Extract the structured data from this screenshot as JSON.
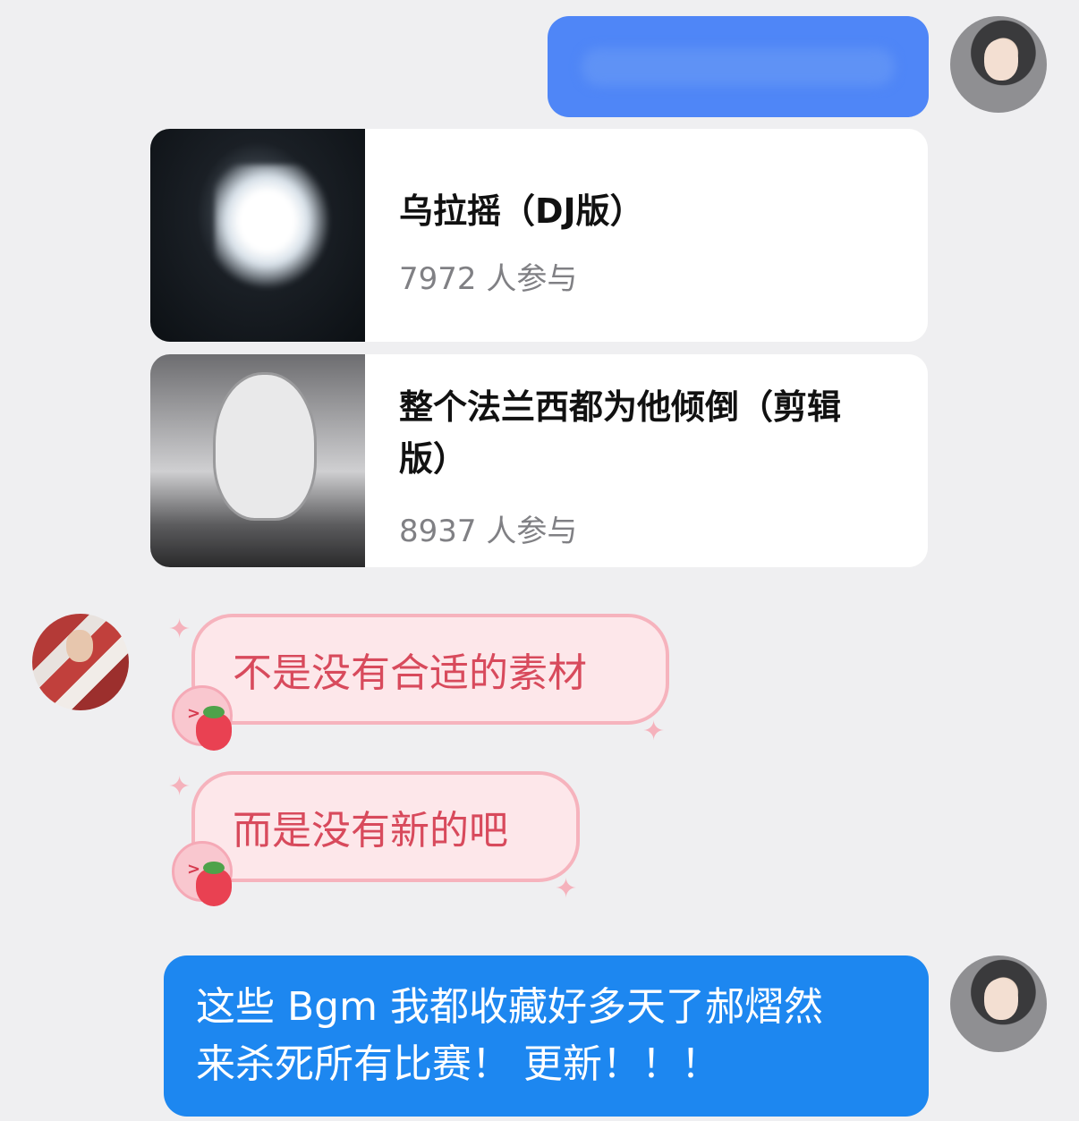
{
  "conversation": {
    "me_message_1": "",
    "cards": [
      {
        "title": "乌拉摇（DJ版）",
        "participants": "7972 人参与"
      },
      {
        "title": "整个法兰西都为他倾倒（剪辑版）",
        "participants": "8937 人参与"
      }
    ],
    "other_messages": [
      "不是没有合适的素材",
      "而是没有新的吧"
    ],
    "me_message_2_line1": "这些 Bgm 我都收藏好多天了郝熠然",
    "me_message_2_line2": "来杀死所有比赛！ 更新！！！"
  },
  "colors": {
    "background": "#efeff1",
    "my_bubble_top": "#4f86f7",
    "my_bubble_bottom": "#1d87f0",
    "pink_bubble": "#fde7ea",
    "pink_text": "#d84a5c"
  },
  "icons": {
    "sticker": "strawberry-face-icon",
    "sparkle": "sparkle-icon"
  }
}
